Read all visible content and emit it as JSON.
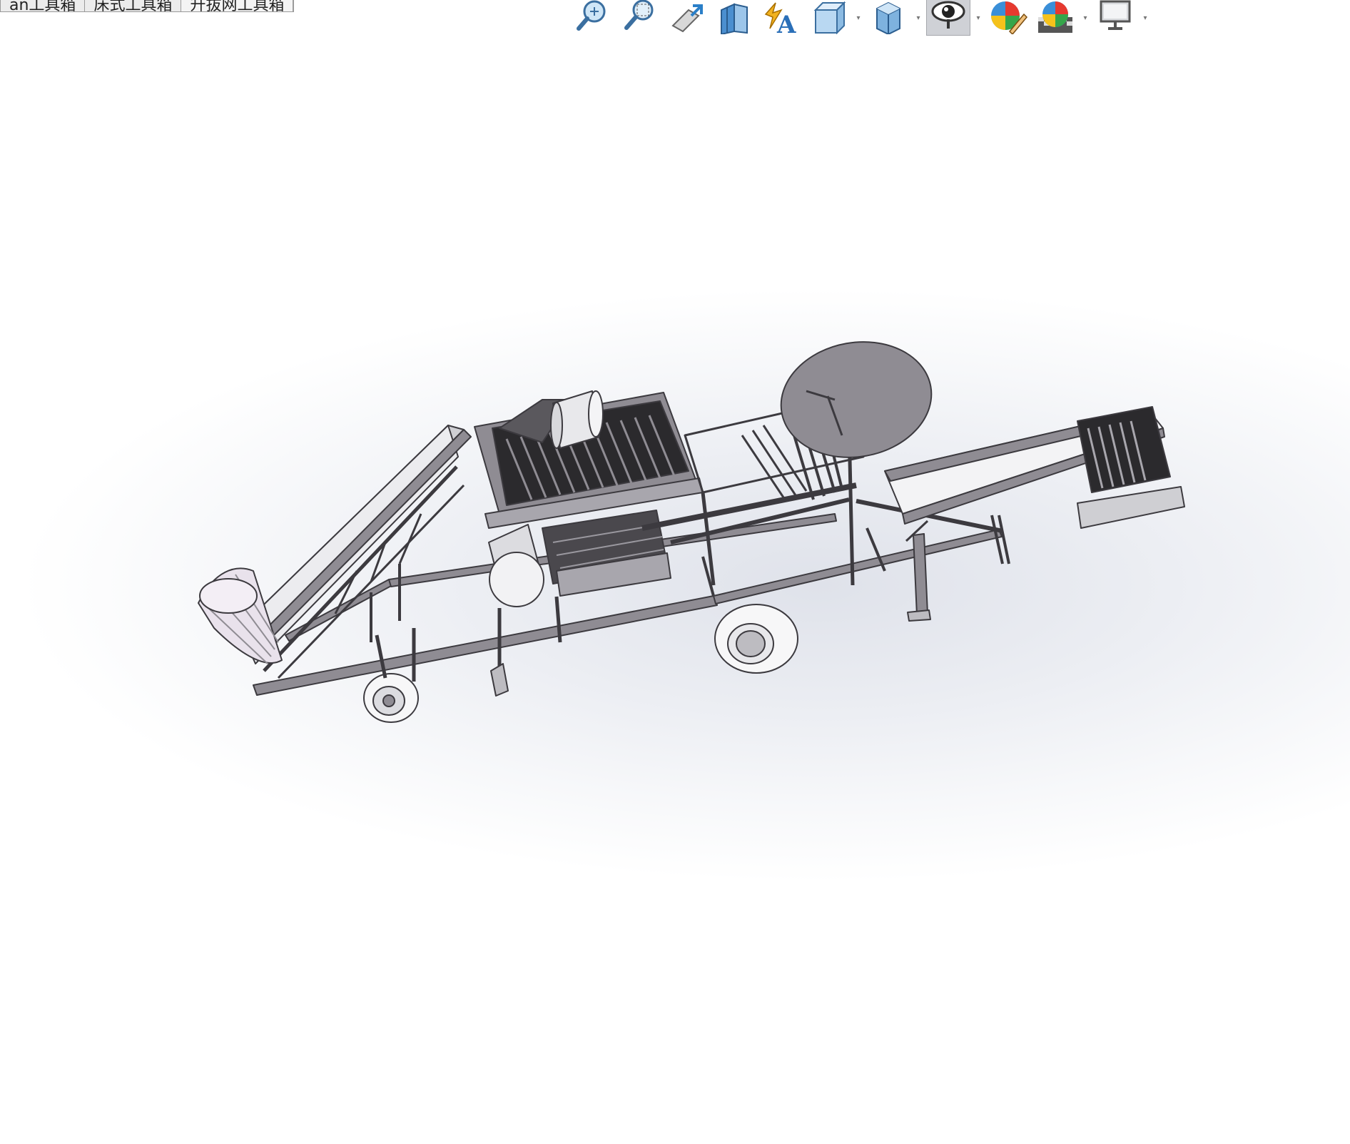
{
  "doc_tabs": [
    {
      "label": "an工具箱"
    },
    {
      "label": "床式工具箱"
    },
    {
      "label": "升拔网工具箱"
    }
  ],
  "view_toolbar": [
    {
      "name": "zoom-to-fit-icon",
      "pressed": false,
      "dropdown": false
    },
    {
      "name": "zoom-to-area-icon",
      "pressed": false,
      "dropdown": false
    },
    {
      "name": "previous-view-icon",
      "pressed": false,
      "dropdown": false
    },
    {
      "name": "section-view-icon",
      "pressed": false,
      "dropdown": false
    },
    {
      "name": "dynamic-annotation-views-icon",
      "pressed": false,
      "dropdown": false
    },
    {
      "name": "view-orientation-icon",
      "pressed": false,
      "dropdown": true
    },
    {
      "name": "display-style-icon",
      "pressed": false,
      "dropdown": true
    },
    {
      "name": "hide-show-items-icon",
      "pressed": true,
      "dropdown": true
    },
    {
      "name": "edit-appearance-icon",
      "pressed": false,
      "dropdown": false
    },
    {
      "name": "apply-scene-icon",
      "pressed": false,
      "dropdown": true
    },
    {
      "name": "view-settings-icon",
      "pressed": false,
      "dropdown": true
    }
  ],
  "colors": {
    "viewport_center": "#dfe2ea",
    "viewport_edge": "#ffffff",
    "steel": "#8f8c93",
    "steel_dark": "#3c3a3f",
    "panel_light": "#ececef"
  },
  "model": {
    "description_icon": "machine-3d-model"
  }
}
